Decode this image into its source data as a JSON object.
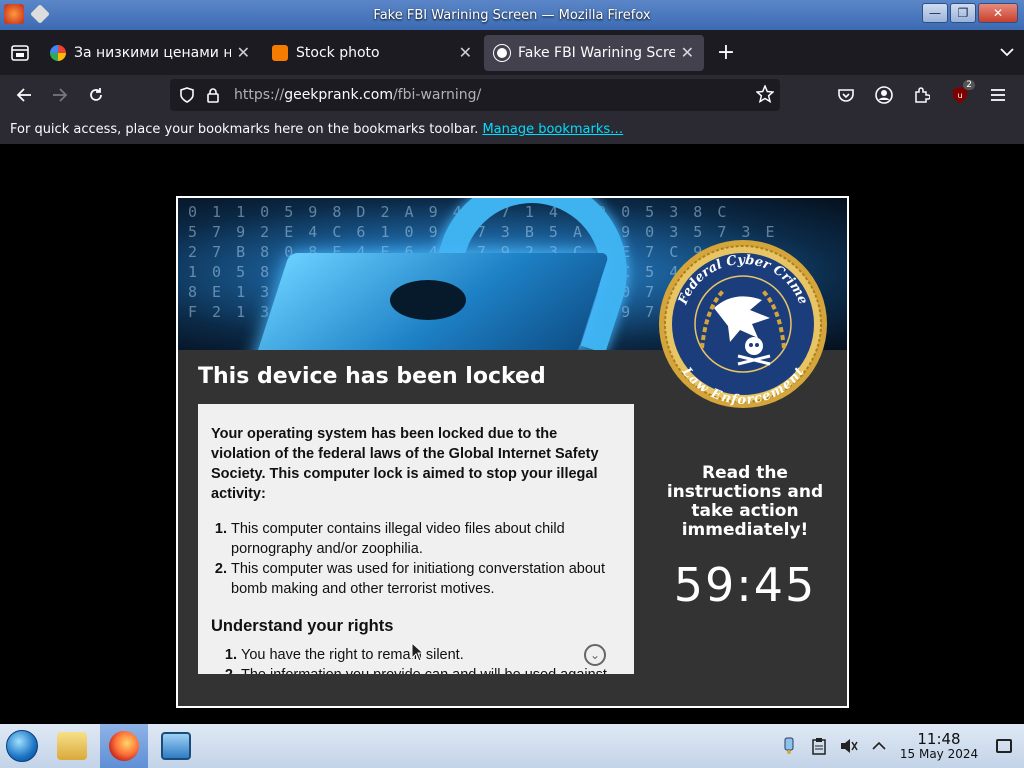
{
  "window": {
    "title": "Fake FBI Warining Screen — Mozilla Firefox",
    "controls": {
      "minimize": "—",
      "maximize": "❐",
      "close": "✕"
    }
  },
  "tabs": [
    {
      "label": "За низкими ценами ни",
      "favicon": "google-icon",
      "color": "#4285f4",
      "active": false
    },
    {
      "label": "Stock photo",
      "favicon": "blogger-icon",
      "color": "#f57c00",
      "active": false
    },
    {
      "label": "Fake FBI Warining Screen",
      "favicon": "geekprank-icon",
      "color": "#ffffff",
      "active": true
    }
  ],
  "new_tab": "+",
  "address_bar": {
    "url_prefix": "https://",
    "url_domain": "geekprank.com",
    "url_path": "/fbi-warning/"
  },
  "extensions": {
    "badge_count": "2"
  },
  "bookmarks_bar": {
    "message": "For quick access, place your bookmarks here on the bookmarks toolbar.",
    "link": "Manage bookmarks…"
  },
  "page": {
    "banner_digits": "0 1 1 0 5 9 8 D 2 A 9 4 3 7 1 4 0 9 0 5 3 8 C\n5 7 9 2 E 4 C 6 1 0 9 2 7 3 B 5 A 3 9 0 3 5 7 3 E\n2 7 B 8 0 8 E 4 E 6 4 8 7 9 2 3 C 8 E 7 C 9 6 7\n1 0 5 8 C 6 5 4 A 6 8 D A 8 1 0 4 6 C 5 4 0 8 1\n8 E 1 3 B 0 0 5 3 A 3 E 5 1 0 5 9 8 0 7 3 2 4\nF 2 1 3 1 6 8 0 5 8 9 8 3 C 8 1 0 6 9 7 4 5 3 1",
    "seal": {
      "top_text": "Federal Cyber Crime",
      "bottom_text": "Law Enforcement"
    },
    "heading": "This device has been locked",
    "intro": "Your operating system has been locked due to the violation of the federal laws of the Global Internet Safety Society. This computer lock is aimed to stop your illegal activity:",
    "violations": [
      "This computer contains illegal video files about child pornography and/or zoophilia.",
      "This computer was used for initiationg converstation about bomb making and other terrorist motives."
    ],
    "rights_heading": "Understand your rights",
    "rights": [
      "You have the right to remain silent.",
      "The information you provide can and will be used against"
    ],
    "side_message": "Read the instructions and take action immediately!",
    "countdown": "59:45"
  },
  "taskbar": {
    "apps": [
      {
        "name": "file-manager-icon",
        "color": "#e8c74a",
        "active": false
      },
      {
        "name": "firefox-icon",
        "color": "#ff7139",
        "active": true
      },
      {
        "name": "control-panel-icon",
        "color": "#4a9ad8",
        "active": false
      }
    ],
    "clock_time": "11:48",
    "clock_date": "15 May 2024"
  }
}
